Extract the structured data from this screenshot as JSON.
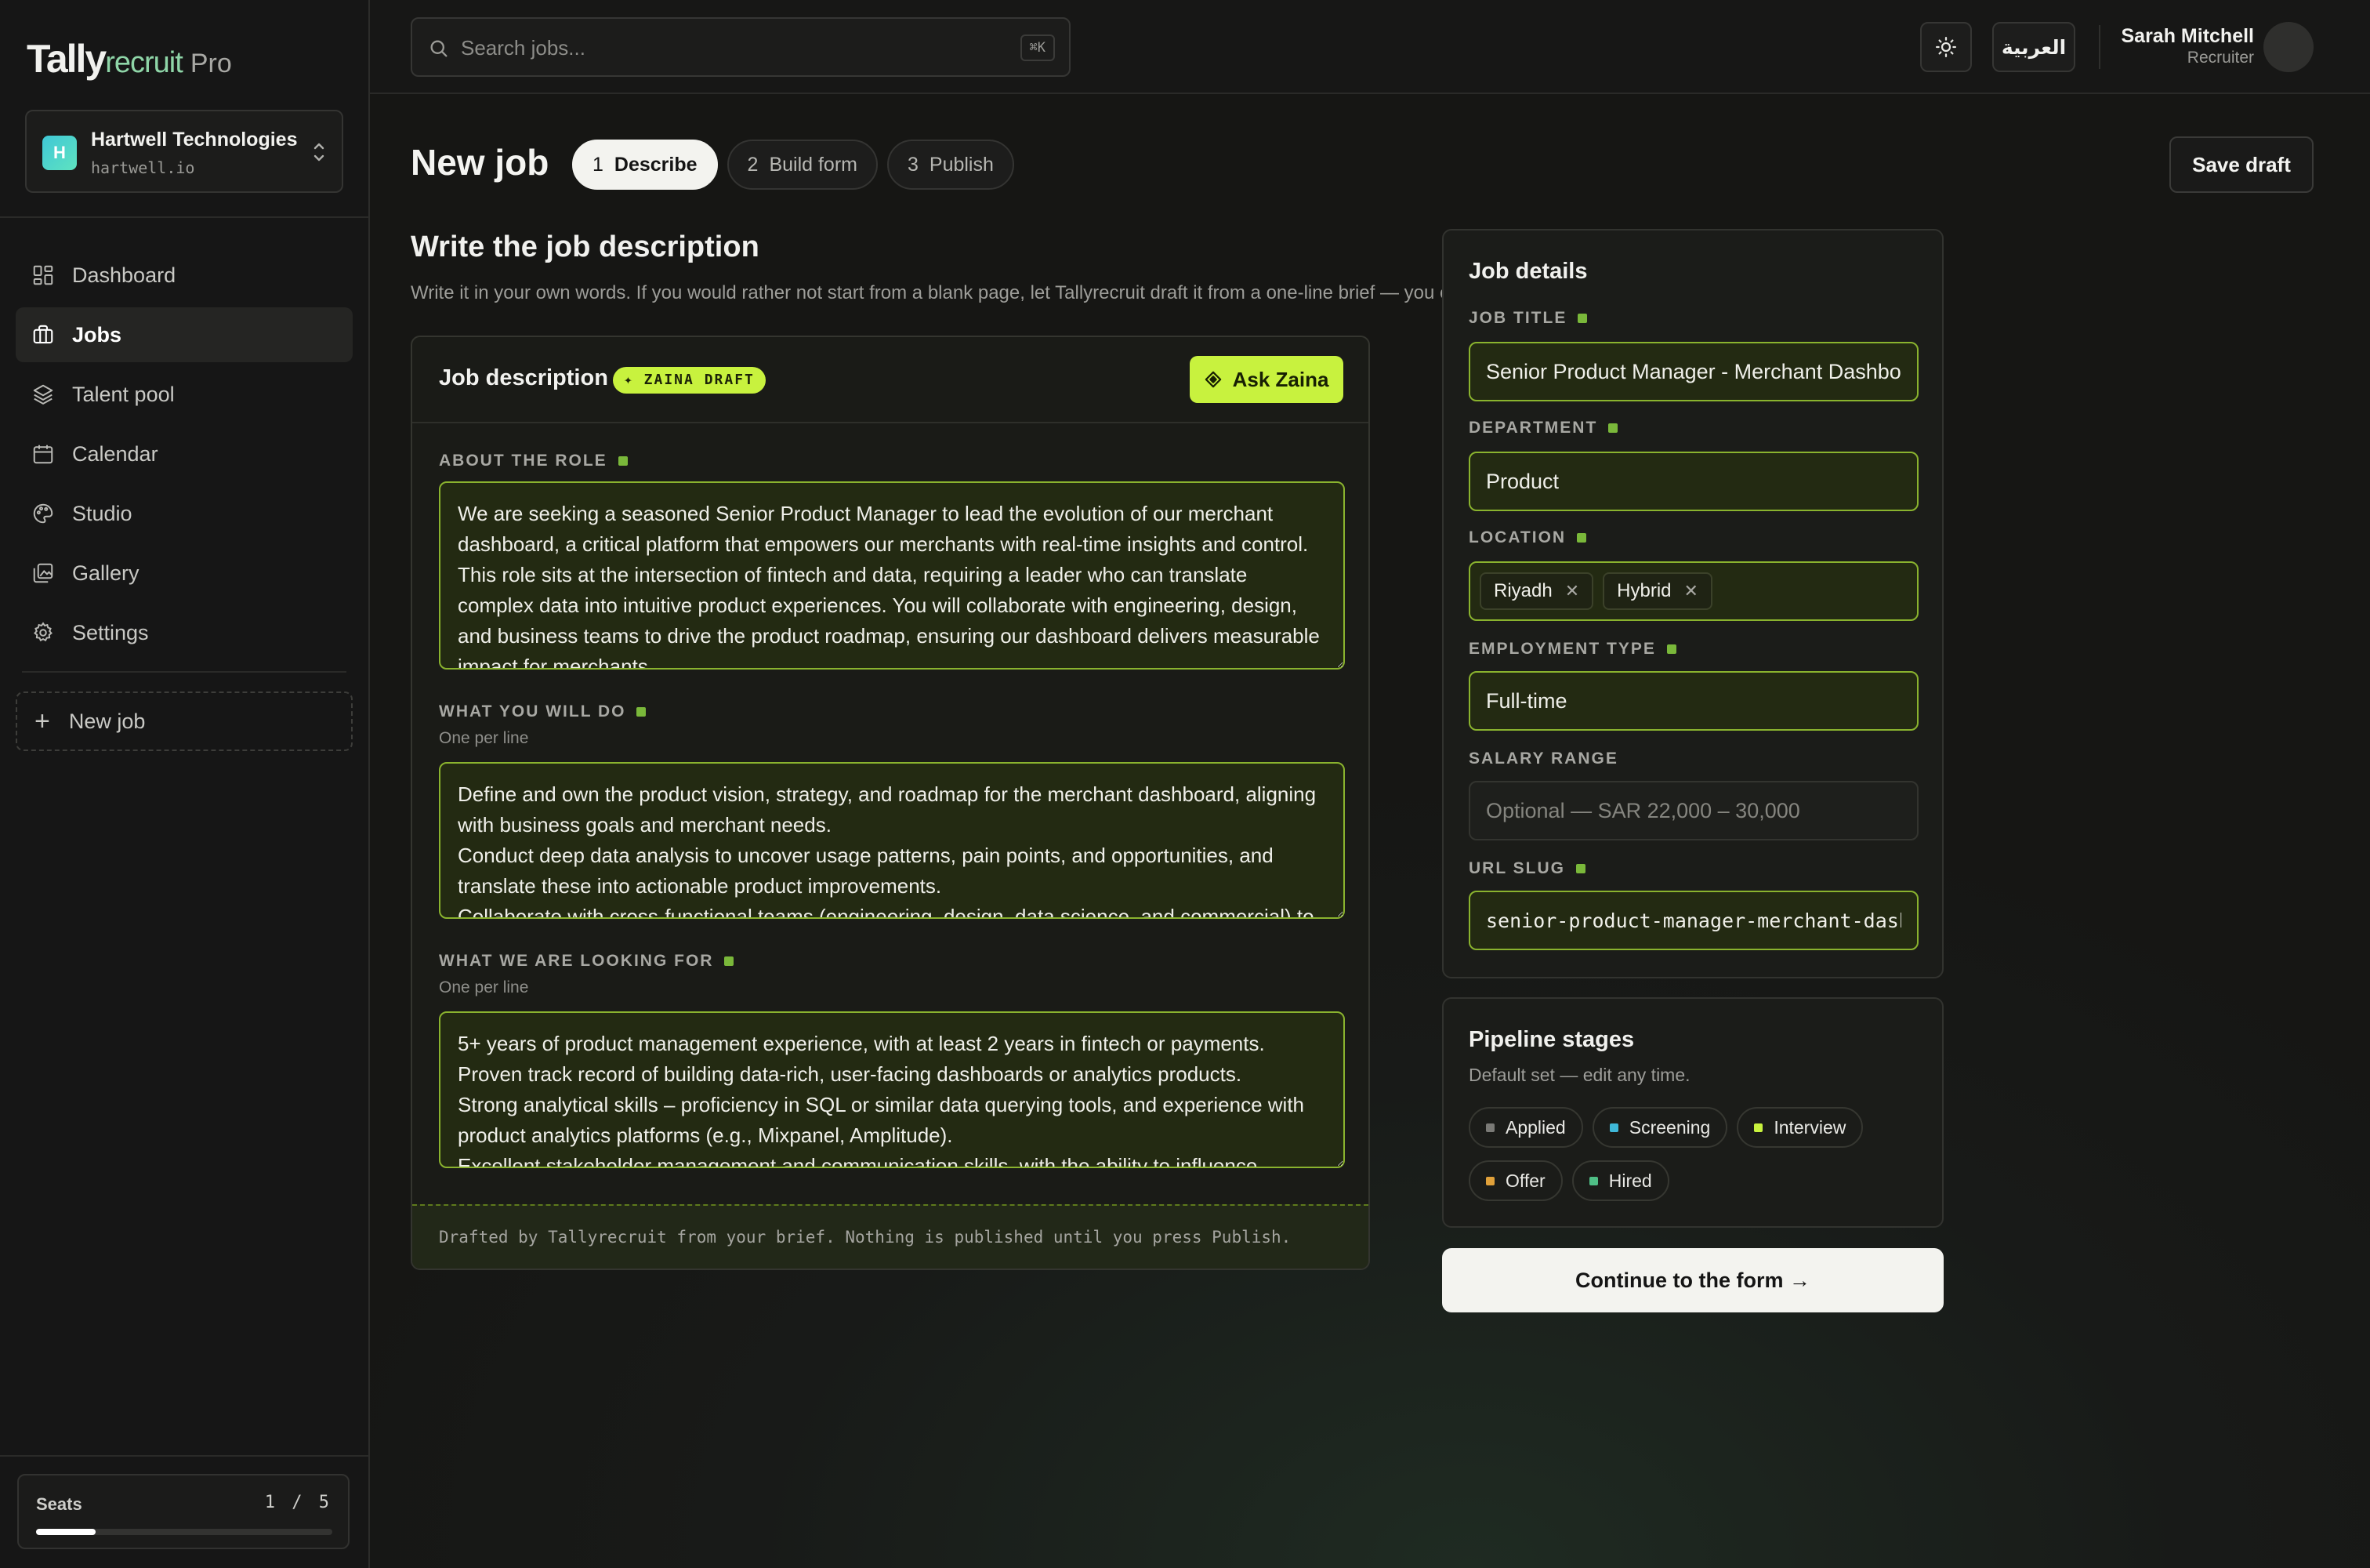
{
  "brand": {
    "name_part1": "Tally",
    "name_part2": "recruit",
    "tier": "Pro"
  },
  "org": {
    "initial": "H",
    "name": "Hartwell Technologies",
    "domain": "hartwell.io"
  },
  "nav": {
    "items": [
      {
        "label": "Dashboard",
        "icon": "dashboard-icon"
      },
      {
        "label": "Jobs",
        "icon": "briefcase-icon",
        "active": true
      },
      {
        "label": "Talent pool",
        "icon": "layers-icon"
      },
      {
        "label": "Calendar",
        "icon": "calendar-icon"
      },
      {
        "label": "Studio",
        "icon": "palette-icon"
      },
      {
        "label": "Gallery",
        "icon": "gallery-icon"
      },
      {
        "label": "Settings",
        "icon": "gear-icon"
      }
    ],
    "new_job": "New job"
  },
  "seats": {
    "label": "Seats",
    "count": "1 / 5",
    "used_fraction": 0.2
  },
  "topbar": {
    "search_placeholder": "Search jobs...",
    "search_shortcut": "⌘K",
    "language": "العربية",
    "user_name": "Sarah Mitchell",
    "user_role": "Recruiter"
  },
  "page": {
    "title": "New job",
    "steps": [
      {
        "num": "1",
        "label": "Describe",
        "active": true
      },
      {
        "num": "2",
        "label": "Build form"
      },
      {
        "num": "3",
        "label": "Publish"
      }
    ],
    "save_draft": "Save draft",
    "section_title": "Write the job description",
    "section_subtitle": "Write it in your own words. If you would rather not start from a blank page, let Tallyrecruit draft it from a one-line brief — you edit every word either way."
  },
  "job_description": {
    "title": "Job description",
    "badge": "✦ ZAINA DRAFT",
    "ask_button": "Ask Zaina",
    "about_label": "ABOUT THE ROLE",
    "about_text": "We are seeking a seasoned Senior Product Manager to lead the evolution of our merchant dashboard, a critical platform that empowers our merchants with real-time insights and control. This role sits at the intersection of fintech and data, requiring a leader who can translate complex data into intuitive product experiences. You will collaborate with engineering, design, and business teams to drive the product roadmap, ensuring our dashboard delivers measurable impact for merchants.",
    "do_label": "WHAT YOU WILL DO",
    "do_hint": "One per line",
    "do_text": "Define and own the product vision, strategy, and roadmap for the merchant dashboard, aligning with business goals and merchant needs.\nConduct deep data analysis to uncover usage patterns, pain points, and opportunities, and translate these into actionable product improvements.\nCollaborate with cross-functional teams (engineering, design, data science, and commercial) to deliver high-impact features on time.\nDrive A/B testing, metric-driven decision-making, and continuous iteration to optimize dashboard performance and user engagement.",
    "looking_label": "WHAT WE ARE LOOKING FOR",
    "looking_hint": "One per line",
    "looking_text": "5+ years of product management experience, with at least 2 years in fintech or payments.\nProven track record of building data-rich, user-facing dashboards or analytics products.\nStrong analytical skills – proficiency in SQL or similar data querying tools, and experience with product analytics platforms (e.g., Mixpanel, Amplitude).\nExcellent stakeholder management and communication skills, with the ability to influence without authority.",
    "footer": "Drafted by Tallyrecruit from your brief. Nothing is published until you press Publish."
  },
  "job_details": {
    "title": "Job details",
    "job_title_label": "JOB TITLE",
    "job_title_value": "Senior Product Manager - Merchant Dashboard",
    "department_label": "DEPARTMENT",
    "department_value": "Product",
    "location_label": "LOCATION",
    "locations": [
      "Riyadh",
      "Hybrid"
    ],
    "employment_label": "EMPLOYMENT TYPE",
    "employment_value": "Full-time",
    "salary_label": "SALARY RANGE",
    "salary_placeholder": "Optional — SAR 22,000 – 30,000",
    "slug_label": "URL SLUG",
    "slug_value": "senior-product-manager-merchant-dashboard"
  },
  "pipeline": {
    "title": "Pipeline stages",
    "subtitle": "Default set — edit any time.",
    "stages": [
      {
        "label": "Applied",
        "color": "#7a7a76"
      },
      {
        "label": "Screening",
        "color": "#3fb8d8"
      },
      {
        "label": "Interview",
        "color": "#c8f23e"
      },
      {
        "label": "Offer",
        "color": "#e0a13a"
      },
      {
        "label": "Hired",
        "color": "#4fbf86"
      }
    ]
  },
  "continue_button": "Continue to the form →",
  "colors": {
    "accent": "#c8f23e",
    "field_border": "#8ab32e",
    "background": "#161614"
  }
}
